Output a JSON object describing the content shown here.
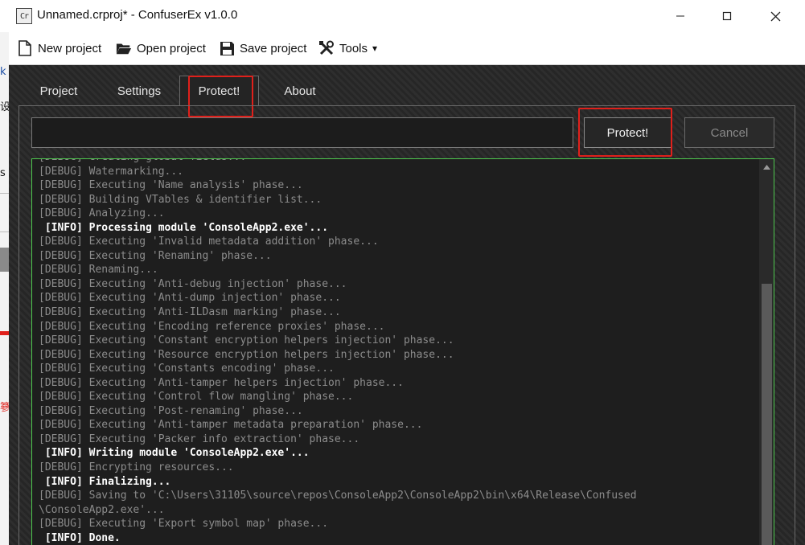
{
  "window": {
    "title": "Unnamed.crproj* - ConfuserEx v1.0.0",
    "icon_label": "Cr",
    "controls": [
      "minimize-icon",
      "maximize-icon",
      "close-icon"
    ]
  },
  "background_app": {
    "marks": [
      "k",
      "设",
      "s",
      "篸"
    ]
  },
  "toolbar": {
    "items": [
      {
        "label": "New project",
        "icon": "new-file-icon"
      },
      {
        "label": "Open project",
        "icon": "folder-open-icon"
      },
      {
        "label": "Save project",
        "icon": "floppy-disk-icon"
      },
      {
        "label": "Tools",
        "icon": "tools-icon",
        "dropdown": "▾"
      }
    ]
  },
  "tabs": [
    {
      "label": "Project",
      "active": false
    },
    {
      "label": "Settings",
      "active": false
    },
    {
      "label": "Protect!",
      "active": true
    },
    {
      "label": "About",
      "active": false
    }
  ],
  "protect_panel": {
    "path_value": "",
    "protect_label": "Protect!",
    "cancel_label": "Cancel"
  },
  "colors": {
    "highlight": "#e0201b",
    "log_border": "#4ec84e"
  },
  "log": [
    {
      "level": "debug",
      "text": "[DEBUG] Creating global fields..."
    },
    {
      "level": "debug",
      "text": "[DEBUG] Watermarking..."
    },
    {
      "level": "debug",
      "text": "[DEBUG] Executing 'Name analysis' phase..."
    },
    {
      "level": "debug",
      "text": "[DEBUG] Building VTables & identifier list..."
    },
    {
      "level": "debug",
      "text": "[DEBUG] Analyzing..."
    },
    {
      "level": "info",
      "text": " [INFO] Processing module 'ConsoleApp2.exe'..."
    },
    {
      "level": "debug",
      "text": "[DEBUG] Executing 'Invalid metadata addition' phase..."
    },
    {
      "level": "debug",
      "text": "[DEBUG] Executing 'Renaming' phase..."
    },
    {
      "level": "debug",
      "text": "[DEBUG] Renaming..."
    },
    {
      "level": "debug",
      "text": "[DEBUG] Executing 'Anti-debug injection' phase..."
    },
    {
      "level": "debug",
      "text": "[DEBUG] Executing 'Anti-dump injection' phase..."
    },
    {
      "level": "debug",
      "text": "[DEBUG] Executing 'Anti-ILDasm marking' phase..."
    },
    {
      "level": "debug",
      "text": "[DEBUG] Executing 'Encoding reference proxies' phase..."
    },
    {
      "level": "debug",
      "text": "[DEBUG] Executing 'Constant encryption helpers injection' phase..."
    },
    {
      "level": "debug",
      "text": "[DEBUG] Executing 'Resource encryption helpers injection' phase..."
    },
    {
      "level": "debug",
      "text": "[DEBUG] Executing 'Constants encoding' phase..."
    },
    {
      "level": "debug",
      "text": "[DEBUG] Executing 'Anti-tamper helpers injection' phase..."
    },
    {
      "level": "debug",
      "text": "[DEBUG] Executing 'Control flow mangling' phase..."
    },
    {
      "level": "debug",
      "text": "[DEBUG] Executing 'Post-renaming' phase..."
    },
    {
      "level": "debug",
      "text": "[DEBUG] Executing 'Anti-tamper metadata preparation' phase..."
    },
    {
      "level": "debug",
      "text": "[DEBUG] Executing 'Packer info extraction' phase..."
    },
    {
      "level": "info",
      "text": " [INFO] Writing module 'ConsoleApp2.exe'..."
    },
    {
      "level": "debug",
      "text": "[DEBUG] Encrypting resources..."
    },
    {
      "level": "info",
      "text": " [INFO] Finalizing..."
    },
    {
      "level": "debug",
      "text": "[DEBUG] Saving to 'C:\\Users\\31105\\source\\repos\\ConsoleApp2\\ConsoleApp2\\bin\\x64\\Release\\Confused"
    },
    {
      "level": "debug",
      "text": "\\ConsoleApp2.exe'..."
    },
    {
      "level": "debug",
      "text": "[DEBUG] Executing 'Export symbol map' phase..."
    },
    {
      "level": "info",
      "text": " [INFO] Done."
    }
  ],
  "scrollbar": {
    "up_icon": "scroll-up-arrow-icon",
    "position": 0.32
  }
}
